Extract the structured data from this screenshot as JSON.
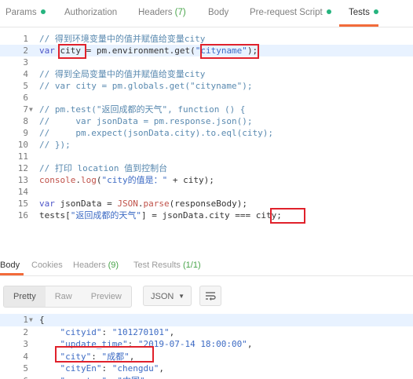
{
  "request_tabs": [
    {
      "label": "Params",
      "dot": true
    },
    {
      "label": "Authorization"
    },
    {
      "label": "Headers",
      "count": "(7)"
    },
    {
      "label": "Body"
    },
    {
      "label": "Pre-request Script",
      "dot": true
    },
    {
      "label": "Tests",
      "dot": true,
      "active": true
    }
  ],
  "tests_script": [
    {
      "n": "1",
      "tokens": [
        {
          "t": "// 得到环境变量中的值并赋值给变量city",
          "c": "comment"
        }
      ]
    },
    {
      "n": "2",
      "active": true,
      "tokens": [
        {
          "t": "var ",
          "c": "kw"
        },
        {
          "t": "city",
          "c": "plain"
        },
        {
          "t": " = pm.environment.get(",
          "c": "plain"
        },
        {
          "t": "\"cityname\"",
          "c": "str"
        },
        {
          "t": ");",
          "c": "plain"
        }
      ]
    },
    {
      "n": "3",
      "tokens": []
    },
    {
      "n": "4",
      "tokens": [
        {
          "t": "// 得到全局变量中的值并赋值给变量city",
          "c": "comment"
        }
      ]
    },
    {
      "n": "5",
      "tokens": [
        {
          "t": "// var city = pm.globals.get(\"cityname\");",
          "c": "comment"
        }
      ]
    },
    {
      "n": "6",
      "tokens": []
    },
    {
      "n": "7",
      "fold": true,
      "tokens": [
        {
          "t": "// pm.test(\"返回成都的天气\", function () {",
          "c": "comment"
        }
      ]
    },
    {
      "n": "8",
      "tokens": [
        {
          "t": "//     var jsonData = pm.response.json();",
          "c": "comment"
        }
      ]
    },
    {
      "n": "9",
      "tokens": [
        {
          "t": "//     pm.expect(jsonData.city).to.eql(city);",
          "c": "comment"
        }
      ]
    },
    {
      "n": "10",
      "tokens": [
        {
          "t": "// });",
          "c": "comment"
        }
      ]
    },
    {
      "n": "11",
      "tokens": []
    },
    {
      "n": "12",
      "tokens": [
        {
          "t": "// 打印 location 值到控制台",
          "c": "comment"
        }
      ]
    },
    {
      "n": "13",
      "tokens": [
        {
          "t": "console",
          "c": "fn"
        },
        {
          "t": ".",
          "c": "plain"
        },
        {
          "t": "log",
          "c": "fn"
        },
        {
          "t": "(",
          "c": "plain"
        },
        {
          "t": "\"city的值是：\"",
          "c": "str"
        },
        {
          "t": " + city);",
          "c": "plain"
        }
      ]
    },
    {
      "n": "14",
      "tokens": []
    },
    {
      "n": "15",
      "tokens": [
        {
          "t": "var ",
          "c": "kw"
        },
        {
          "t": "jsonData = ",
          "c": "plain"
        },
        {
          "t": "JSON",
          "c": "fn"
        },
        {
          "t": ".",
          "c": "plain"
        },
        {
          "t": "parse",
          "c": "fn"
        },
        {
          "t": "(responseBody);",
          "c": "plain"
        }
      ]
    },
    {
      "n": "16",
      "tokens": [
        {
          "t": "tests[",
          "c": "plain"
        },
        {
          "t": "\"返回成都的天气\"",
          "c": "str"
        },
        {
          "t": "] = jsonData.city === ",
          "c": "plain"
        },
        {
          "t": "city;",
          "c": "plain"
        }
      ]
    }
  ],
  "response_tabs": [
    {
      "label": "Body",
      "active": true
    },
    {
      "label": "Cookies"
    },
    {
      "label": "Headers",
      "count": "(9)"
    },
    {
      "label": "Test Results",
      "count": "(1/1)"
    }
  ],
  "view_modes": [
    "Pretty",
    "Raw",
    "Preview"
  ],
  "active_view_mode": "Pretty",
  "format_select": "JSON",
  "response_lines": [
    {
      "n": "1",
      "fold": true,
      "active": true,
      "tokens": [
        {
          "t": "{",
          "c": "plain"
        }
      ]
    },
    {
      "n": "2",
      "tokens": [
        {
          "t": "    ",
          "c": "plain"
        },
        {
          "t": "\"cityid\"",
          "c": "key"
        },
        {
          "t": ": ",
          "c": "plain"
        },
        {
          "t": "\"101270101\"",
          "c": "str"
        },
        {
          "t": ",",
          "c": "plain"
        }
      ]
    },
    {
      "n": "3",
      "tokens": [
        {
          "t": "    ",
          "c": "plain"
        },
        {
          "t": "\"update_time\"",
          "c": "key"
        },
        {
          "t": ": ",
          "c": "plain"
        },
        {
          "t": "\"2019-07-14 18:00:00\"",
          "c": "str"
        },
        {
          "t": ",",
          "c": "plain"
        }
      ]
    },
    {
      "n": "4",
      "tokens": [
        {
          "t": "    ",
          "c": "plain"
        },
        {
          "t": "\"city\"",
          "c": "key"
        },
        {
          "t": ": ",
          "c": "plain"
        },
        {
          "t": "\"成都\"",
          "c": "str"
        },
        {
          "t": ",",
          "c": "plain"
        }
      ]
    },
    {
      "n": "5",
      "tokens": [
        {
          "t": "    ",
          "c": "plain"
        },
        {
          "t": "\"cityEn\"",
          "c": "key"
        },
        {
          "t": ": ",
          "c": "plain"
        },
        {
          "t": "\"chengdu\"",
          "c": "str"
        },
        {
          "t": ",",
          "c": "plain"
        }
      ]
    },
    {
      "n": "6",
      "tokens": [
        {
          "t": "    ",
          "c": "plain"
        },
        {
          "t": "\"country\"",
          "c": "key"
        },
        {
          "t": ": ",
          "c": "plain"
        },
        {
          "t": "\"中国\"",
          "c": "str"
        },
        {
          "t": ",",
          "c": "plain"
        }
      ]
    }
  ],
  "colors": {
    "accent": "#f26b3a",
    "dot": "#26b47f",
    "highlight_box": "#e0212b"
  }
}
